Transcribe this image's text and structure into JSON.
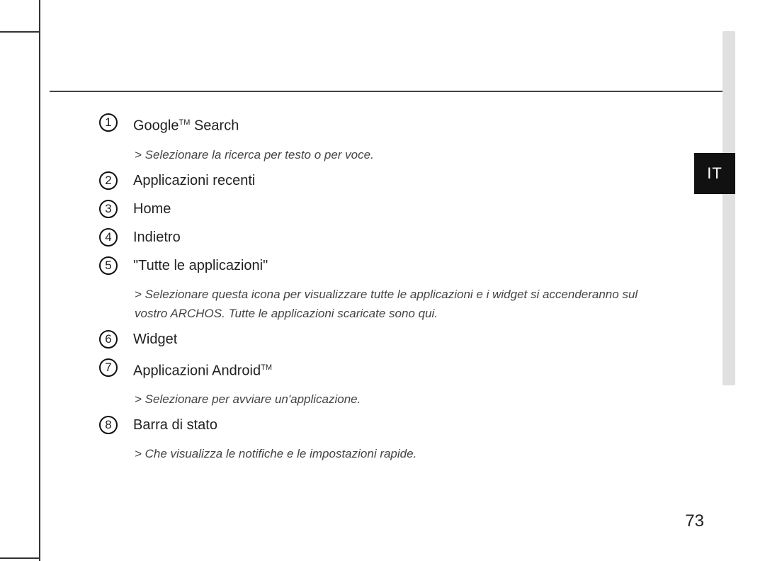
{
  "lang_tab": "IT",
  "page_number": "73",
  "items": [
    {
      "num": "1",
      "label_pre": "Google",
      "label_sup": "TM",
      "label_post": " Search",
      "desc": " > Selezionare la ricerca per testo o per voce."
    },
    {
      "num": "2",
      "label": "Applicazioni recenti"
    },
    {
      "num": "3",
      "label": "Home"
    },
    {
      "num": "4",
      "label": "Indietro"
    },
    {
      "num": "5",
      "label": "\"Tutte le applicazioni\"",
      "desc": " > Selezionare questa icona per visualizzare tutte le applicazioni e i widget si accenderanno sul vostro ARCHOS. Tutte le applicazioni scaricate sono qui."
    },
    {
      "num": "6",
      "label": "Widget"
    },
    {
      "num": "7",
      "label_pre": "Applicazioni Android",
      "label_sup": "TM",
      "label_post": "",
      "desc": " > Selezionare per avviare un'applicazione."
    },
    {
      "num": "8",
      "label": "Barra di stato",
      "desc": " > Che visualizza le notifiche e le impostazioni rapide."
    }
  ]
}
